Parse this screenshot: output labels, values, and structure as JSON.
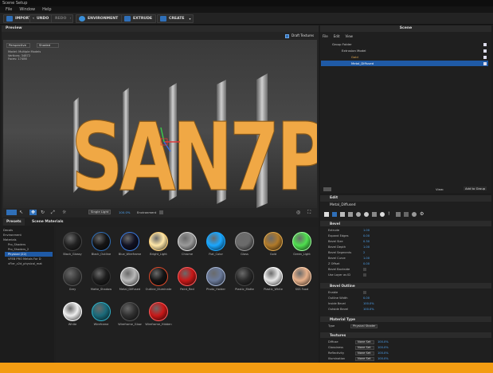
{
  "window": {
    "title": "Scene Setup"
  },
  "menu": [
    "File",
    "Window",
    "Help"
  ],
  "toolbar": {
    "import": "IMPORT",
    "undo": "UNDO",
    "redo": "REDO",
    "environment": "ENVIRONMENT",
    "extrude": "EXTRUDE",
    "create": "CREATE"
  },
  "preview": {
    "title": "Preview",
    "draft_textures": "Draft Textures",
    "view_mode": "Perspective",
    "shading": "Shaded",
    "stats": [
      "Model: Multiple Models",
      "Vertices: 34872",
      "Faces: 17486"
    ],
    "scene_text": "SAN7P",
    "lighting": "Single Light",
    "zoom": "100.0%",
    "environment_label": "Environment"
  },
  "scene": {
    "title": "Scene",
    "menu": [
      "File",
      "Edit",
      "View"
    ],
    "tree": [
      {
        "label": "Group Folder",
        "indent": 0,
        "selected": false
      },
      {
        "label": "Extrusion Model",
        "indent": 1,
        "selected": false
      },
      {
        "label": "Gold",
        "indent": 2,
        "selected": false
      },
      {
        "label": "Metal_Diffused",
        "indent": 2,
        "selected": true
      }
    ],
    "view_label": "View:",
    "add_to_group": "Add to Group"
  },
  "edit": {
    "title": "Edit",
    "material_name": "Metal_Diffused",
    "bevel": {
      "header": "Bevel",
      "rows": [
        {
          "label": "Extrude",
          "value": "1.00"
        },
        {
          "label": "Expand Edges",
          "value": "0.00"
        },
        {
          "label": "Bevel Size",
          "value": "0.30"
        },
        {
          "label": "Bevel Depth",
          "value": "1.00"
        },
        {
          "label": "Bevel Segments",
          "value": "2"
        },
        {
          "label": "Bevel Curve",
          "value": "1.00"
        },
        {
          "label": "Z Offset",
          "value": "0.00"
        },
        {
          "label": "Bevel Backside",
          "value": ""
        },
        {
          "label": "Use Layer as ID",
          "value": ""
        }
      ]
    },
    "outline": {
      "header": "Bevel Outline",
      "rows": [
        {
          "label": "Enable",
          "value": ""
        },
        {
          "label": "Outline Width",
          "value": "0.00"
        },
        {
          "label": "Inside Bevel",
          "value": "100.0%"
        },
        {
          "label": "Outside Bevel",
          "value": "100.0%"
        }
      ]
    },
    "material_type": {
      "header": "Material Type",
      "type_label": "Type",
      "type_value": "Physical Shader"
    },
    "textures": {
      "header": "Textures",
      "rows": [
        {
          "label": "Diffuse",
          "slot": "None Set",
          "value": "100.0%"
        },
        {
          "label": "Glossiness",
          "slot": "None Set",
          "value": "100.0%"
        },
        {
          "label": "Reflectivity",
          "slot": "None Set",
          "value": "100.0%"
        },
        {
          "label": "Illumination",
          "slot": "None Set",
          "value": "100.0%"
        }
      ]
    }
  },
  "materials": {
    "tab_presets": "Presets",
    "tab_scene": "Scene Materials",
    "folders": [
      {
        "label": "Decals",
        "selected": false
      },
      {
        "label": "Environment",
        "selected": false
      },
      {
        "label": "Materials",
        "selected": false
      },
      {
        "label": "Pro_Shaders",
        "selected": false
      },
      {
        "label": "Pro_Shaders_2",
        "selected": false
      },
      {
        "label": "Physical (22)",
        "selected": true
      },
      {
        "label": "VFEB PRO Metals For D",
        "selected": false
      },
      {
        "label": "vFler_v2d_physical_mat",
        "selected": false
      }
    ],
    "items": [
      {
        "name": "Black_Glossy",
        "color": "#222222",
        "ring": "#444"
      },
      {
        "name": "Black_Outline",
        "color": "#151515",
        "ring": "#2f6fb8"
      },
      {
        "name": "Blue_Wireframe",
        "color": "#111122",
        "ring": "#3a7be0"
      },
      {
        "name": "Bright_Light",
        "color": "#ffe7a8",
        "ring": "#ffd27a"
      },
      {
        "name": "Chrome",
        "color": "#9a9a9a",
        "ring": "#dddddd"
      },
      {
        "name": "Flat_Color",
        "color": "#1aa7ff",
        "ring": "#1aa7ff"
      },
      {
        "name": "Glass",
        "color": "#6b6b6b",
        "ring": "#999999"
      },
      {
        "name": "Gold",
        "color": "#b07a2a",
        "ring": "#e0a84e"
      },
      {
        "name": "Green_Light",
        "color": "#4fe04f",
        "ring": "#9fff9f"
      },
      {
        "name": "Grey",
        "color": "#3a3a3a",
        "ring": "#555"
      },
      {
        "name": "Matte_Shadow",
        "color": "#1e1e1e",
        "ring": "#333"
      },
      {
        "name": "Metal_Diffused",
        "color": "#b9b9b9",
        "ring": "#e9e9e9"
      },
      {
        "name": "Outline_Illuminate",
        "color": "#151515",
        "ring": "#e04a2a"
      },
      {
        "name": "Paint_Red",
        "color": "#c81818",
        "ring": "#ff5a5a"
      },
      {
        "name": "Photo_Holder",
        "color": "#6a7a9a",
        "ring": "#a9b9d9"
      },
      {
        "name": "Plastic_Matte",
        "color": "#2a2a2a",
        "ring": "#444"
      },
      {
        "name": "Plastic_White",
        "color": "#e8e8e8",
        "ring": "#ffffff"
      },
      {
        "name": "SSS Food",
        "color": "#e7b08a",
        "ring": "#ffd2b0"
      },
      {
        "name": "White",
        "color": "#eeeeee",
        "ring": "#ffffff"
      },
      {
        "name": "Wireframe",
        "color": "#1a6a7a",
        "ring": "#2fb0c8"
      },
      {
        "name": "Wireframe_Glow",
        "color": "#303030",
        "ring": "#555"
      },
      {
        "name": "Wireframe_Hidden",
        "color": "#c81818",
        "ring": "#ff5a5a"
      }
    ]
  },
  "colors": {
    "accent": "#2f6fb8",
    "selection": "#1f5aa6",
    "footer": "#f39c12",
    "gold_text": "#f0a845"
  }
}
